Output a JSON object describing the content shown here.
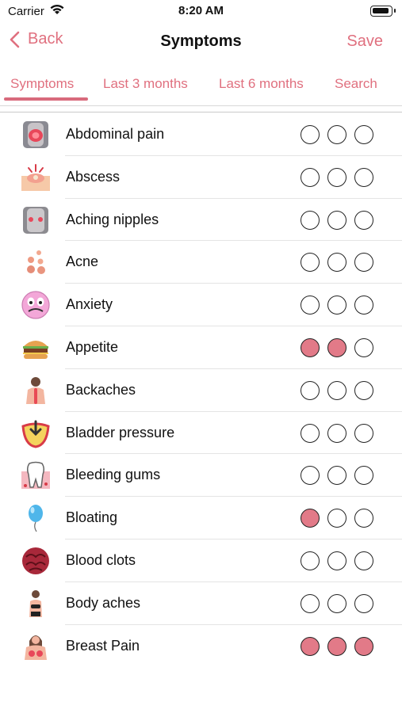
{
  "status": {
    "carrier": "Carrier",
    "time": "8:20 AM"
  },
  "nav": {
    "back_label": "Back",
    "title": "Symptoms",
    "save_label": "Save"
  },
  "tabs": [
    {
      "label": "Symptoms",
      "active": true
    },
    {
      "label": "Last 3 months",
      "active": false
    },
    {
      "label": "Last 6 months",
      "active": false
    },
    {
      "label": "Search",
      "active": false
    }
  ],
  "symptoms": [
    {
      "label": "Abdominal pain",
      "icon": "abdomen-icon",
      "severity": 0
    },
    {
      "label": "Abscess",
      "icon": "abscess-icon",
      "severity": 0
    },
    {
      "label": "Aching nipples",
      "icon": "chest-icon",
      "severity": 0
    },
    {
      "label": "Acne",
      "icon": "acne-icon",
      "severity": 0
    },
    {
      "label": "Anxiety",
      "icon": "anxious-face-icon",
      "severity": 0
    },
    {
      "label": "Appetite",
      "icon": "burger-icon",
      "severity": 2
    },
    {
      "label": "Backaches",
      "icon": "back-icon",
      "severity": 0
    },
    {
      "label": "Bladder pressure",
      "icon": "bladder-icon",
      "severity": 0
    },
    {
      "label": "Bleeding gums",
      "icon": "tooth-icon",
      "severity": 0
    },
    {
      "label": "Bloating",
      "icon": "balloon-icon",
      "severity": 1
    },
    {
      "label": "Blood clots",
      "icon": "blood-clot-icon",
      "severity": 0
    },
    {
      "label": "Body aches",
      "icon": "body-icon",
      "severity": 0
    },
    {
      "label": "Breast Pain",
      "icon": "breast-icon",
      "severity": 3
    }
  ],
  "accent_color": "#e0707f",
  "filled_dot_color": "#e27a88"
}
